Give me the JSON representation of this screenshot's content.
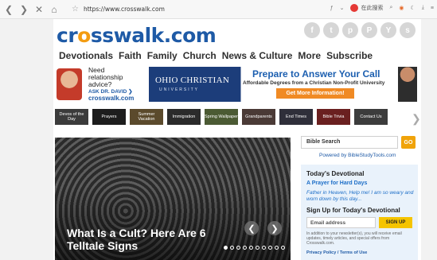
{
  "browser": {
    "url": "https://www.crosswalk.com",
    "search_engine_label": "在此搜索",
    "controls": [
      "back",
      "forward",
      "close",
      "home"
    ]
  },
  "site": {
    "logo_parts": [
      "cr",
      "o",
      "sswalk.com"
    ],
    "social_icons": [
      "f",
      "t",
      "p",
      "P",
      "Y",
      "s"
    ],
    "nav": [
      "Devotionals",
      "Faith",
      "Family",
      "Church",
      "News & Culture",
      "More",
      "Subscribe"
    ]
  },
  "ads": {
    "left": {
      "line1": "Need",
      "line2": "relationship",
      "line3": "advice?",
      "ask": "ASK DR. DAVID ❯",
      "brand": "crosswalk.com"
    },
    "right": {
      "school": "OHIO CHRISTIAN",
      "school_sub": "UNIVERSITY",
      "headline": "Prepare to Answer Your Call",
      "subline": "Affordable Degrees from a Christian Non-Profit University",
      "cta": "Get More Information!"
    }
  },
  "categories": [
    {
      "label": "Devos of the Day",
      "color": "#3b3b3b"
    },
    {
      "label": "Prayers",
      "color": "#1d1d1d"
    },
    {
      "label": "Summer Vacation",
      "color": "#5b4a2c"
    },
    {
      "label": "Immigration",
      "color": "#2b2b2b"
    },
    {
      "label": "Spring Wallpaper",
      "color": "#4b5a33"
    },
    {
      "label": "Grandparents",
      "color": "#4a3a36"
    },
    {
      "label": "End Times",
      "color": "#2f2f3a"
    },
    {
      "label": "Bible Trivia",
      "color": "#6a2020"
    },
    {
      "label": "Contact Us",
      "color": "#3c3c3c"
    }
  ],
  "hero": {
    "title": "What Is a Cult? Here Are 6 Telltale Signs",
    "slides": 10,
    "active_slide": 1
  },
  "sidebar": {
    "bible_search": "Bible Search",
    "go": "GO",
    "powered": "Powered by BibleStudyTools.com",
    "devotional_heading": "Today's Devotional",
    "devotional_title": "A Prayer for Hard Days",
    "devotional_excerpt": "Father in Heaven, Help me! I am so weary and worn down by this day...",
    "signup_heading": "Sign Up for Today's Devotional",
    "email_placeholder": "Email address",
    "signup_button": "SIGN UP",
    "fine_print": "In addition to your newsletter(s), you will receive email updates, timely articles, and special offers from Crosswalk.com.",
    "policy": "Privacy Policy / Terms of Use"
  }
}
